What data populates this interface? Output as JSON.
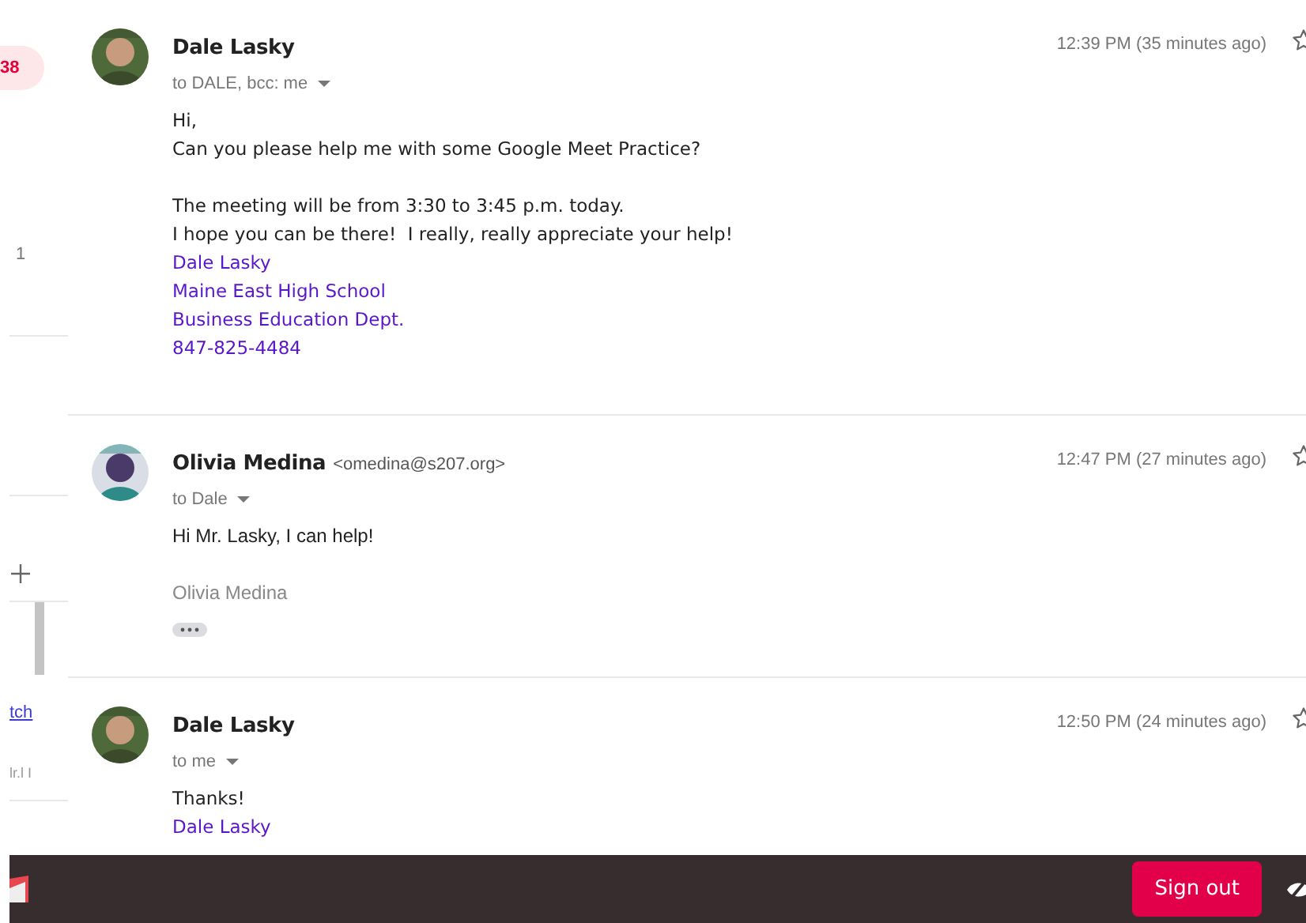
{
  "sidebar": {
    "badge": "38",
    "count": "1",
    "link": "tch",
    "snippet": "lr.l I"
  },
  "messages": [
    {
      "sender": "Dale Lasky",
      "recipients": "to DALE, bcc: me",
      "time": "12:39 PM (35 minutes ago)",
      "starred": false,
      "kind": "handwritten",
      "paragraphs": [
        [
          {
            "text": "Hi,",
            "kind": "plain"
          },
          {
            "text": "Can you please help me with some Google Meet Practice?",
            "kind": "plain"
          }
        ],
        [
          {
            "text": "The meeting will be from 3:30 to 3:45 p.m. today.",
            "kind": "plain"
          },
          {
            "text": "I hope you can be there!  I really, really appreciate your help!",
            "kind": "plain"
          },
          {
            "text": "Dale Lasky",
            "kind": "signature"
          },
          {
            "text": "Maine East High School",
            "kind": "signature"
          },
          {
            "text": "Business Education Dept.",
            "kind": "signature"
          },
          {
            "text": "847-825-4484",
            "kind": "signature"
          }
        ]
      ]
    },
    {
      "sender": "Olivia Medina",
      "email": "<omedina@s207.org>",
      "recipients": "to Dale",
      "time": "12:47 PM (27 minutes ago)",
      "starred": false,
      "kind": "plain",
      "paragraphs": [
        [
          {
            "text": "Hi Mr. Lasky, I can help!",
            "kind": "plain"
          }
        ],
        [
          {
            "text": "Olivia Medina",
            "kind": "muted"
          }
        ]
      ],
      "trimmed": true
    },
    {
      "sender": "Dale Lasky",
      "recipients": "to me",
      "time": "12:50 PM (24 minutes ago)",
      "starred": false,
      "kind": "handwritten",
      "paragraphs": [
        [
          {
            "text": "Thanks!",
            "kind": "plain"
          },
          {
            "text": "Dale Lasky",
            "kind": "signature"
          }
        ]
      ]
    }
  ],
  "footer": {
    "sign_out": "Sign out"
  }
}
